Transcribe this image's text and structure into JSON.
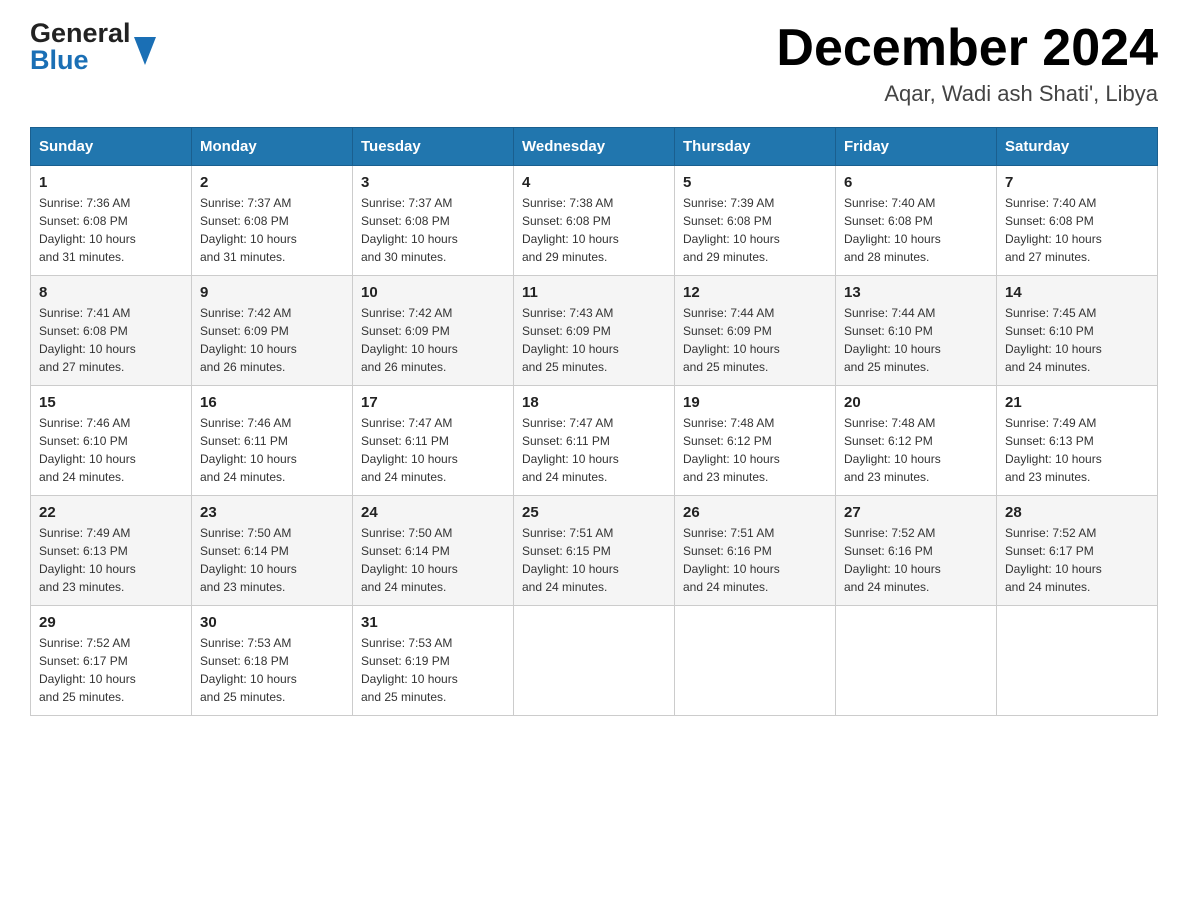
{
  "header": {
    "logo": {
      "general": "General",
      "blue": "Blue"
    },
    "title": "December 2024",
    "location": "Aqar, Wadi ash Shati', Libya"
  },
  "weekdays": [
    "Sunday",
    "Monday",
    "Tuesday",
    "Wednesday",
    "Thursday",
    "Friday",
    "Saturday"
  ],
  "weeks": [
    [
      {
        "day": "1",
        "sunrise": "7:36 AM",
        "sunset": "6:08 PM",
        "daylight": "10 hours and 31 minutes."
      },
      {
        "day": "2",
        "sunrise": "7:37 AM",
        "sunset": "6:08 PM",
        "daylight": "10 hours and 31 minutes."
      },
      {
        "day": "3",
        "sunrise": "7:37 AM",
        "sunset": "6:08 PM",
        "daylight": "10 hours and 30 minutes."
      },
      {
        "day": "4",
        "sunrise": "7:38 AM",
        "sunset": "6:08 PM",
        "daylight": "10 hours and 29 minutes."
      },
      {
        "day": "5",
        "sunrise": "7:39 AM",
        "sunset": "6:08 PM",
        "daylight": "10 hours and 29 minutes."
      },
      {
        "day": "6",
        "sunrise": "7:40 AM",
        "sunset": "6:08 PM",
        "daylight": "10 hours and 28 minutes."
      },
      {
        "day": "7",
        "sunrise": "7:40 AM",
        "sunset": "6:08 PM",
        "daylight": "10 hours and 27 minutes."
      }
    ],
    [
      {
        "day": "8",
        "sunrise": "7:41 AM",
        "sunset": "6:08 PM",
        "daylight": "10 hours and 27 minutes."
      },
      {
        "day": "9",
        "sunrise": "7:42 AM",
        "sunset": "6:09 PM",
        "daylight": "10 hours and 26 minutes."
      },
      {
        "day": "10",
        "sunrise": "7:42 AM",
        "sunset": "6:09 PM",
        "daylight": "10 hours and 26 minutes."
      },
      {
        "day": "11",
        "sunrise": "7:43 AM",
        "sunset": "6:09 PM",
        "daylight": "10 hours and 25 minutes."
      },
      {
        "day": "12",
        "sunrise": "7:44 AM",
        "sunset": "6:09 PM",
        "daylight": "10 hours and 25 minutes."
      },
      {
        "day": "13",
        "sunrise": "7:44 AM",
        "sunset": "6:10 PM",
        "daylight": "10 hours and 25 minutes."
      },
      {
        "day": "14",
        "sunrise": "7:45 AM",
        "sunset": "6:10 PM",
        "daylight": "10 hours and 24 minutes."
      }
    ],
    [
      {
        "day": "15",
        "sunrise": "7:46 AM",
        "sunset": "6:10 PM",
        "daylight": "10 hours and 24 minutes."
      },
      {
        "day": "16",
        "sunrise": "7:46 AM",
        "sunset": "6:11 PM",
        "daylight": "10 hours and 24 minutes."
      },
      {
        "day": "17",
        "sunrise": "7:47 AM",
        "sunset": "6:11 PM",
        "daylight": "10 hours and 24 minutes."
      },
      {
        "day": "18",
        "sunrise": "7:47 AM",
        "sunset": "6:11 PM",
        "daylight": "10 hours and 24 minutes."
      },
      {
        "day": "19",
        "sunrise": "7:48 AM",
        "sunset": "6:12 PM",
        "daylight": "10 hours and 23 minutes."
      },
      {
        "day": "20",
        "sunrise": "7:48 AM",
        "sunset": "6:12 PM",
        "daylight": "10 hours and 23 minutes."
      },
      {
        "day": "21",
        "sunrise": "7:49 AM",
        "sunset": "6:13 PM",
        "daylight": "10 hours and 23 minutes."
      }
    ],
    [
      {
        "day": "22",
        "sunrise": "7:49 AM",
        "sunset": "6:13 PM",
        "daylight": "10 hours and 23 minutes."
      },
      {
        "day": "23",
        "sunrise": "7:50 AM",
        "sunset": "6:14 PM",
        "daylight": "10 hours and 23 minutes."
      },
      {
        "day": "24",
        "sunrise": "7:50 AM",
        "sunset": "6:14 PM",
        "daylight": "10 hours and 24 minutes."
      },
      {
        "day": "25",
        "sunrise": "7:51 AM",
        "sunset": "6:15 PM",
        "daylight": "10 hours and 24 minutes."
      },
      {
        "day": "26",
        "sunrise": "7:51 AM",
        "sunset": "6:16 PM",
        "daylight": "10 hours and 24 minutes."
      },
      {
        "day": "27",
        "sunrise": "7:52 AM",
        "sunset": "6:16 PM",
        "daylight": "10 hours and 24 minutes."
      },
      {
        "day": "28",
        "sunrise": "7:52 AM",
        "sunset": "6:17 PM",
        "daylight": "10 hours and 24 minutes."
      }
    ],
    [
      {
        "day": "29",
        "sunrise": "7:52 AM",
        "sunset": "6:17 PM",
        "daylight": "10 hours and 25 minutes."
      },
      {
        "day": "30",
        "sunrise": "7:53 AM",
        "sunset": "6:18 PM",
        "daylight": "10 hours and 25 minutes."
      },
      {
        "day": "31",
        "sunrise": "7:53 AM",
        "sunset": "6:19 PM",
        "daylight": "10 hours and 25 minutes."
      },
      null,
      null,
      null,
      null
    ]
  ],
  "labels": {
    "sunrise": "Sunrise:",
    "sunset": "Sunset:",
    "daylight": "Daylight:"
  }
}
